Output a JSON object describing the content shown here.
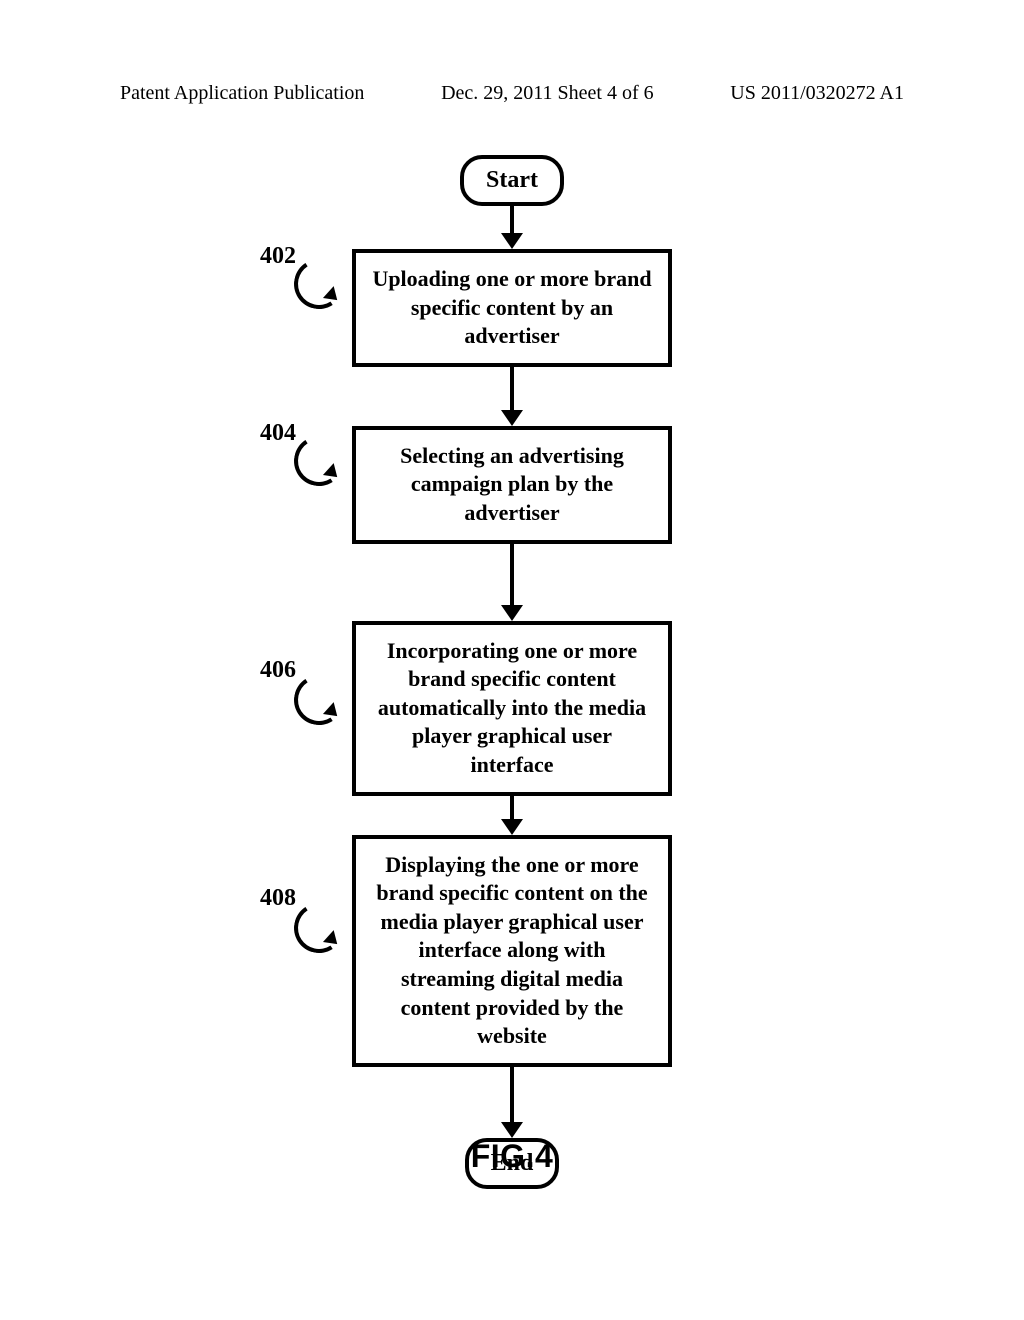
{
  "header": {
    "left": "Patent Application Publication",
    "mid": "Dec. 29, 2011   Sheet 4 of 6",
    "right": "US 2011/0320272 A1"
  },
  "terminator": {
    "start": "Start",
    "end": "End"
  },
  "steps": [
    {
      "ref": "402",
      "text": "Uploading one or more brand specific content by an advertiser"
    },
    {
      "ref": "404",
      "text": "Selecting an advertising campaign plan by the advertiser"
    },
    {
      "ref": "406",
      "text": "Incorporating one or more brand specific content automatically into the media player graphical user interface"
    },
    {
      "ref": "408",
      "text": "Displaying the one or more brand specific content on the media player graphical user interface along with streaming digital media content provided by the website"
    }
  ],
  "figure_label": "FIG.4"
}
